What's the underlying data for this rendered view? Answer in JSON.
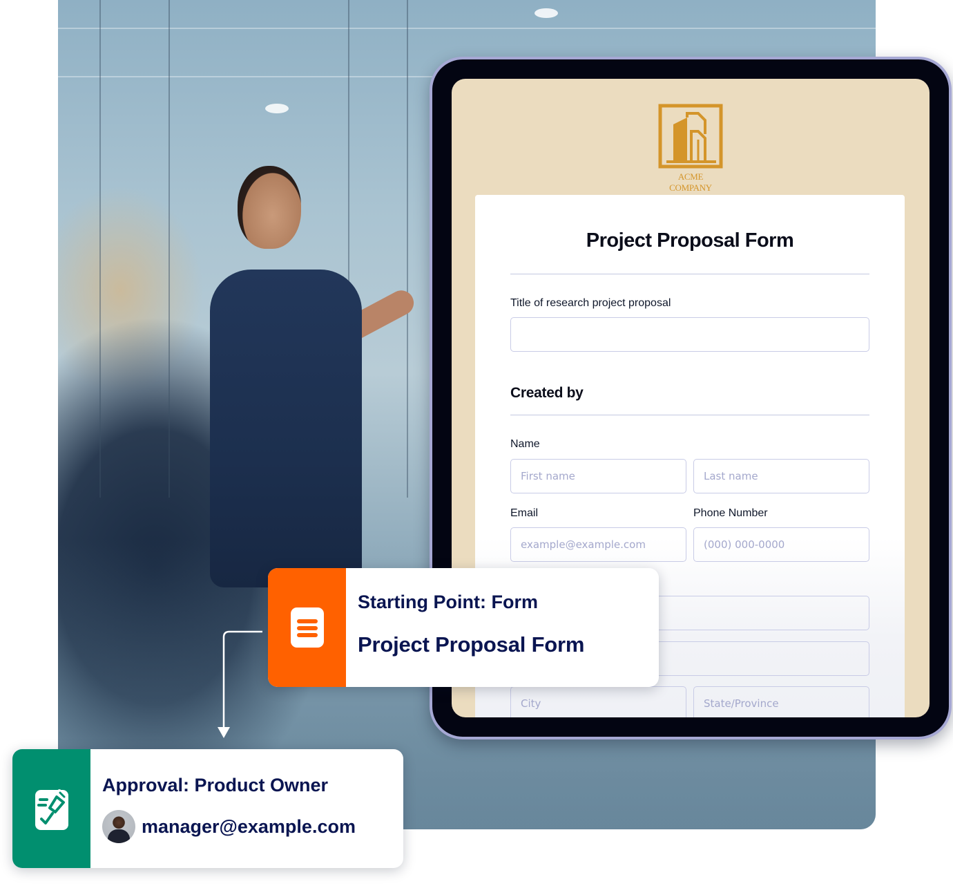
{
  "background": {
    "description": "Office meeting photo: presenter pointing at screen"
  },
  "tablet": {
    "logo": {
      "icon": "building-icon",
      "company": "ACME COMPANY",
      "color": "#d4952a"
    },
    "form": {
      "title": "Project Proposal Form",
      "fields": {
        "project_title": {
          "label": "Title of research project proposal",
          "value": "",
          "placeholder": ""
        },
        "section_created_by": "Created by",
        "name_label": "Name",
        "first_name": {
          "placeholder": "First name",
          "value": ""
        },
        "last_name": {
          "placeholder": "Last name",
          "value": ""
        },
        "email": {
          "label": "Email",
          "placeholder": "example@example.com",
          "value": ""
        },
        "phone": {
          "label": "Phone Number",
          "placeholder": "(000) 000-0000",
          "value": ""
        },
        "address_line_1": {
          "placeholder": "",
          "value": ""
        },
        "address_line_2": {
          "placeholder": "",
          "value": ""
        },
        "city": {
          "placeholder": "City",
          "value": ""
        },
        "state": {
          "placeholder": "State/Province",
          "value": ""
        }
      }
    }
  },
  "workflow": {
    "start_card": {
      "icon": "form-icon",
      "kicker": "Starting Point: Form",
      "title": "Project Proposal Form",
      "color": "#ff6100"
    },
    "approval_card": {
      "icon": "signature-approval-icon",
      "kicker": "Approval: Product Owner",
      "assignee_email": "manager@example.com",
      "color": "#018f6f"
    }
  }
}
